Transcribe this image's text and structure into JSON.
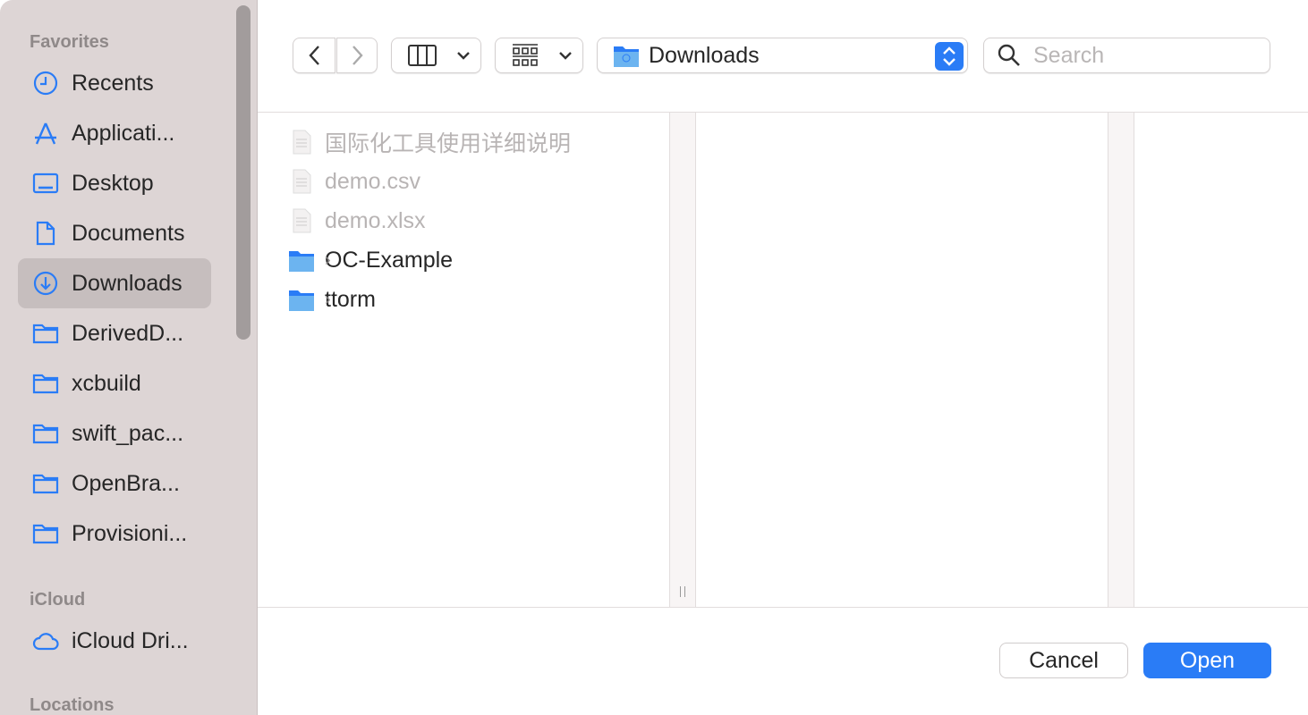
{
  "sidebar": {
    "favorites_title": "Favorites",
    "favorites": [
      {
        "label": "Recents",
        "icon": "clock-icon"
      },
      {
        "label": "Applicati...",
        "icon": "applications-icon"
      },
      {
        "label": "Desktop",
        "icon": "desktop-icon"
      },
      {
        "label": "Documents",
        "icon": "document-icon"
      },
      {
        "label": "Downloads",
        "icon": "download-icon",
        "selected": true
      },
      {
        "label": "DerivedD...",
        "icon": "folder-icon"
      },
      {
        "label": "xcbuild",
        "icon": "folder-icon"
      },
      {
        "label": "swift_pac...",
        "icon": "folder-icon"
      },
      {
        "label": "OpenBra...",
        "icon": "folder-icon"
      },
      {
        "label": "Provisioni...",
        "icon": "folder-icon"
      }
    ],
    "icloud_title": "iCloud",
    "icloud": [
      {
        "label": "iCloud Dri...",
        "icon": "cloud-icon"
      }
    ],
    "locations_title": "Locations"
  },
  "toolbar": {
    "location": "Downloads",
    "search_placeholder": "Search"
  },
  "files": [
    {
      "name": "国际化工具使用详细说明",
      "type": "document",
      "disabled": true
    },
    {
      "name": "demo.csv",
      "type": "csv",
      "disabled": true
    },
    {
      "name": "demo.xlsx",
      "type": "xlsx",
      "disabled": true
    },
    {
      "name": "OC-Example",
      "type": "folder",
      "disabled": false
    },
    {
      "name": "ttorm",
      "type": "folder",
      "disabled": false
    }
  ],
  "footer": {
    "cancel": "Cancel",
    "open": "Open"
  },
  "colors": {
    "accent": "#2a7cf6",
    "sidebar": "#ddd5d5",
    "folder": "#6cb4f0"
  }
}
